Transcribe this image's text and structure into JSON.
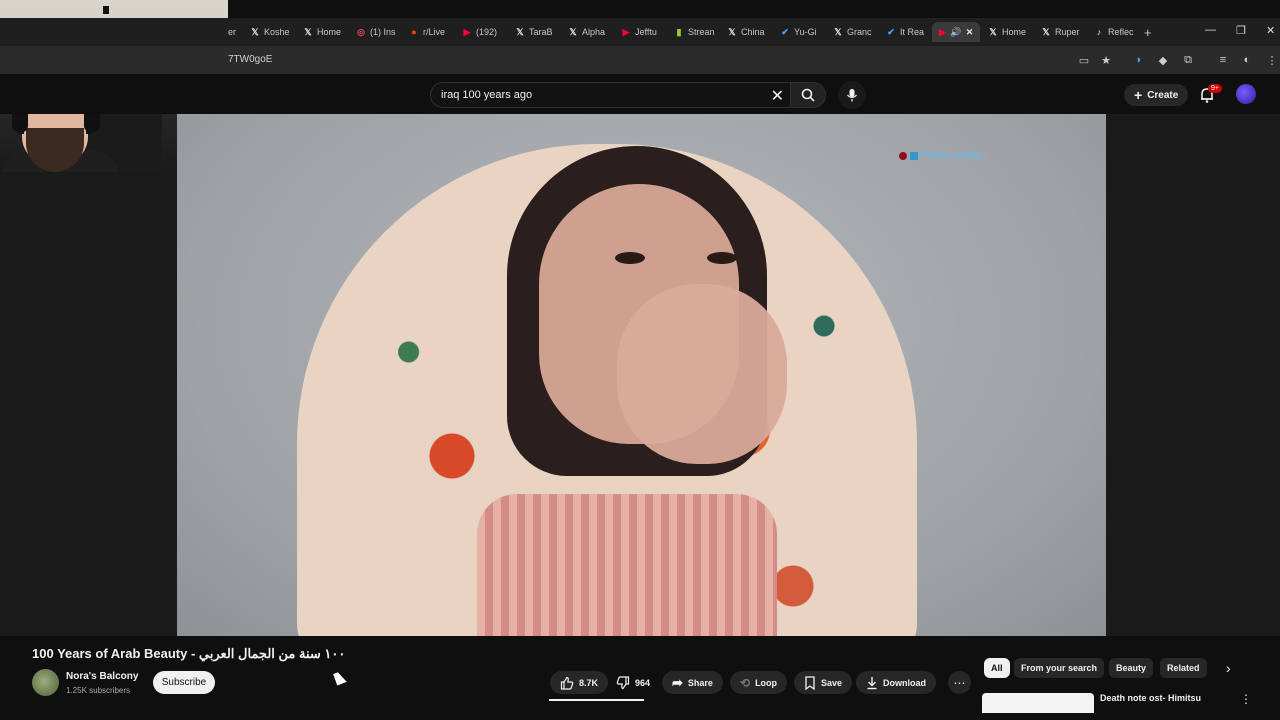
{
  "browser": {
    "tabs": [
      {
        "label": "er",
        "icon": "generic"
      },
      {
        "label": "Koshe",
        "icon": "X"
      },
      {
        "label": "Home",
        "icon": "X"
      },
      {
        "label": "(1) Ins",
        "icon": "instagram"
      },
      {
        "label": "r/Live",
        "icon": "reddit"
      },
      {
        "label": "(192)",
        "icon": "youtube"
      },
      {
        "label": "TaraB",
        "icon": "X"
      },
      {
        "label": "Alpha",
        "icon": "X"
      },
      {
        "label": "Jefftu",
        "icon": "youtube"
      },
      {
        "label": "Strean",
        "icon": "chart"
      },
      {
        "label": "China",
        "icon": "X"
      },
      {
        "label": "Yu-Gi",
        "icon": "check"
      },
      {
        "label": "Granc",
        "icon": "X"
      },
      {
        "label": "It Rea",
        "icon": "check"
      },
      {
        "label": "",
        "icon": "youtube",
        "active": true
      },
      {
        "label": "Home",
        "icon": "X"
      },
      {
        "label": "Ruper",
        "icon": "X"
      },
      {
        "label": "Reflec",
        "icon": "tiktok"
      }
    ],
    "url": "7TW0goE"
  },
  "header": {
    "search_value": "iraq 100 years ago",
    "create_label": "Create",
    "notification_count": "9+"
  },
  "overlay": {
    "username": "Freeze_Cube :"
  },
  "video": {
    "title": "100 Years of Arab Beauty - ١٠٠ سنة من الجمال العربي",
    "channel_name": "Nora's Balcony",
    "subscribers": "1.25K subscribers",
    "subscribe_label": "Subscribe",
    "likes": "8.7K",
    "dislikes": "964",
    "share_label": "Share",
    "loop_label": "Loop",
    "save_label": "Save",
    "download_label": "Download"
  },
  "chips": [
    "All",
    "From your search",
    "Beauty",
    "Related"
  ],
  "recommendation": {
    "title": "Death note ost- Himitsu"
  },
  "colors": {
    "background": "#0f0f0f",
    "pill": "#272727",
    "link_overlay": "#4fc3ff",
    "badge": "#cc0000"
  }
}
